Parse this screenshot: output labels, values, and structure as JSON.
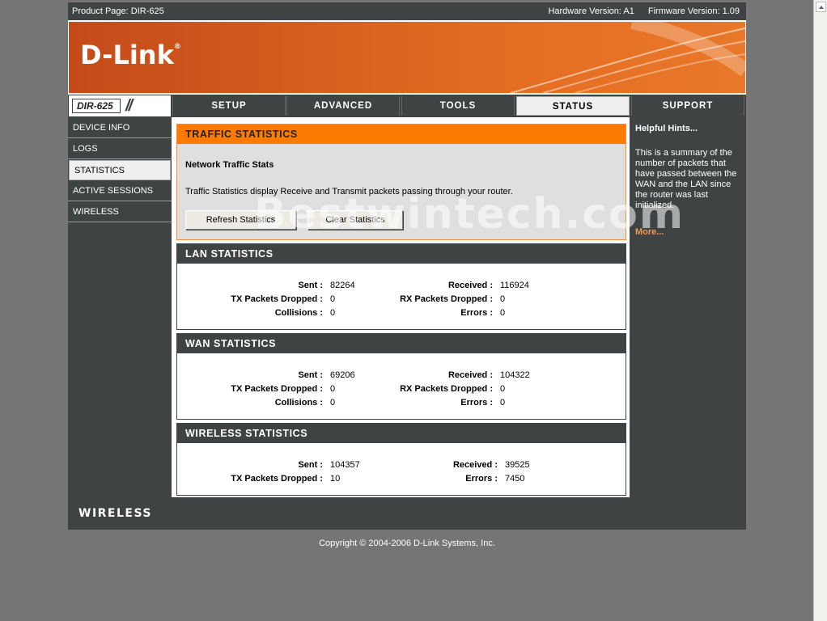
{
  "topbar": {
    "product": "Product Page: DIR-625",
    "hardware": "Hardware Version: A1",
    "firmware": "Firmware Version: 1.09"
  },
  "banner": {
    "logo": "D-Link",
    "registered": "®"
  },
  "nav": {
    "model": "DIR-625",
    "model_slashes": "//",
    "tabs": [
      {
        "label": "SETUP"
      },
      {
        "label": "ADVANCED"
      },
      {
        "label": "TOOLS"
      },
      {
        "label": "STATUS",
        "active": true
      },
      {
        "label": "SUPPORT"
      }
    ]
  },
  "sidebar": {
    "items": [
      {
        "label": "DEVICE INFO"
      },
      {
        "label": "LOGS"
      },
      {
        "label": "STATISTICS",
        "active": true
      },
      {
        "label": "ACTIVE SESSIONS"
      },
      {
        "label": "WIRELESS"
      }
    ]
  },
  "traffic": {
    "title": "TRAFFIC STATISTICS",
    "subtitle": "Network Traffic Stats",
    "description": "Traffic Statistics display Receive and Transmit packets passing through your router.",
    "refresh_label": "Refresh Statistics",
    "clear_label": "Clear Statistics"
  },
  "labels": {
    "sent": "Sent :",
    "received": "Received :",
    "tx_dropped": "TX Packets Dropped :",
    "rx_dropped": "RX Packets Dropped :",
    "collisions": "Collisions :",
    "errors": "Errors :"
  },
  "lan": {
    "title": "LAN STATISTICS",
    "sent": "82264",
    "received": "116924",
    "tx_dropped": "0",
    "rx_dropped": "0",
    "collisions": "0",
    "errors": "0"
  },
  "wan": {
    "title": "WAN STATISTICS",
    "sent": "69206",
    "received": "104322",
    "tx_dropped": "0",
    "rx_dropped": "0",
    "collisions": "0",
    "errors": "0"
  },
  "wireless": {
    "title": "WIRELESS STATISTICS",
    "sent": "104357",
    "received": "39525",
    "tx_dropped": "10",
    "errors": "7450"
  },
  "hints": {
    "title": "Helpful Hints...",
    "text": "This is a summary of the number of packets that have passed between the WAN and the LAN since the router was last initialized.",
    "more": "More..."
  },
  "watermark": "Bestwintech.com",
  "footer": {
    "brand": "WIRELESS",
    "copyright": "Copyright © 2004-2006 D-Link Systems, Inc."
  },
  "colors": {
    "accent": "#fd7b03",
    "dark": "#404343",
    "banner": "#d9601f",
    "background": "#757575"
  }
}
